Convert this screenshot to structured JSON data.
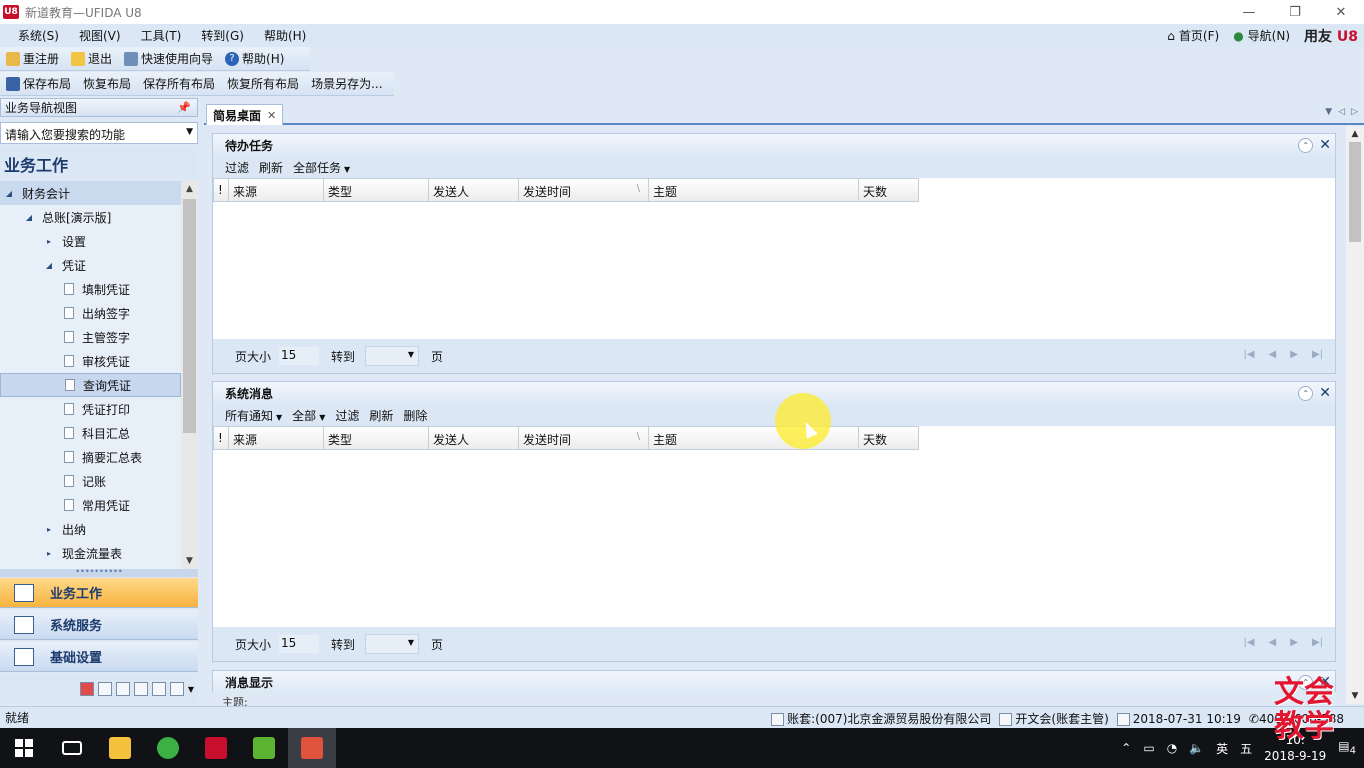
{
  "window": {
    "title": "新道教育—UFIDA U8",
    "logo": "U8"
  },
  "menu": {
    "items": [
      "系统(S)",
      "视图(V)",
      "工具(T)",
      "转到(G)",
      "帮助(H)"
    ],
    "right": {
      "home": "首页(F)",
      "nav": "导航(N)",
      "brand_text": "用友",
      "brand_u8": "U8"
    }
  },
  "toolbar1": {
    "register": "重注册",
    "exit": "退出",
    "wizard": "快速使用向导",
    "help": "帮助(H)"
  },
  "toolbar2": {
    "save_layout": "保存布局",
    "restore_layout": "恢复布局",
    "save_all": "保存所有布局",
    "restore_all": "恢复所有布局",
    "save_as": "场景另存为..."
  },
  "nav": {
    "header": "业务导航视图",
    "pin": "ᵖ",
    "search_placeholder": "请输入您要搜索的功能",
    "title": "业务工作",
    "tree": [
      {
        "label": "财务会计",
        "level": 0,
        "expanded": true
      },
      {
        "label": "总账[演示版]",
        "level": 1,
        "expanded": true
      },
      {
        "label": "设置",
        "level": 2,
        "expanded": false
      },
      {
        "label": "凭证",
        "level": 2,
        "expanded": true
      },
      {
        "label": "填制凭证",
        "level": 3
      },
      {
        "label": "出纳签字",
        "level": 3
      },
      {
        "label": "主管签字",
        "level": 3
      },
      {
        "label": "审核凭证",
        "level": 3
      },
      {
        "label": "查询凭证",
        "level": 3,
        "selected": true
      },
      {
        "label": "凭证打印",
        "level": 3
      },
      {
        "label": "科目汇总",
        "level": 3
      },
      {
        "label": "摘要汇总表",
        "level": 3
      },
      {
        "label": "记账",
        "level": 3
      },
      {
        "label": "常用凭证",
        "level": 3
      },
      {
        "label": "出纳",
        "level": 2,
        "expanded": false
      },
      {
        "label": "现金流量表",
        "level": 2,
        "expanded": false
      }
    ],
    "buttons": {
      "business": "业务工作",
      "system": "系统服务",
      "basic": "基础设置"
    }
  },
  "tab": {
    "label": "简易桌面"
  },
  "panel1": {
    "title": "待办任务",
    "tools": {
      "filter": "过滤",
      "refresh": "刷新",
      "all_tasks": "全部任务"
    }
  },
  "panel2": {
    "title": "系统消息",
    "tools": {
      "all_notice": "所有通知",
      "all": "全部",
      "filter": "过滤",
      "refresh": "刷新",
      "delete": "删除"
    }
  },
  "panel3": {
    "title": "消息显示",
    "sub": "主题:"
  },
  "grid": {
    "flag": "!",
    "columns": [
      "来源",
      "类型",
      "发送人",
      "发送时间",
      "主题",
      "天数"
    ]
  },
  "pager": {
    "page_size_label": "页大小",
    "page_size": "15",
    "goto_label": "转到",
    "page_label": "页"
  },
  "status": {
    "left": "就绪",
    "account": "账套:(007)北京金源贸易股份有限公司",
    "user": "开文会(账套主管)",
    "datetime": "2018-07-31 10:19",
    "phone": "4006-600-588"
  },
  "taskbar": {
    "time": "10:",
    "date": "2018-9-19",
    "ime_lang": "英",
    "ime_mode": "五",
    "notify_count": "4"
  },
  "watermark": {
    "line1": "文会",
    "line2": "教学"
  },
  "colors": {
    "accent": "#5d87c0",
    "active_nav": "#f7b33e",
    "brand_red": "#c8102e"
  }
}
